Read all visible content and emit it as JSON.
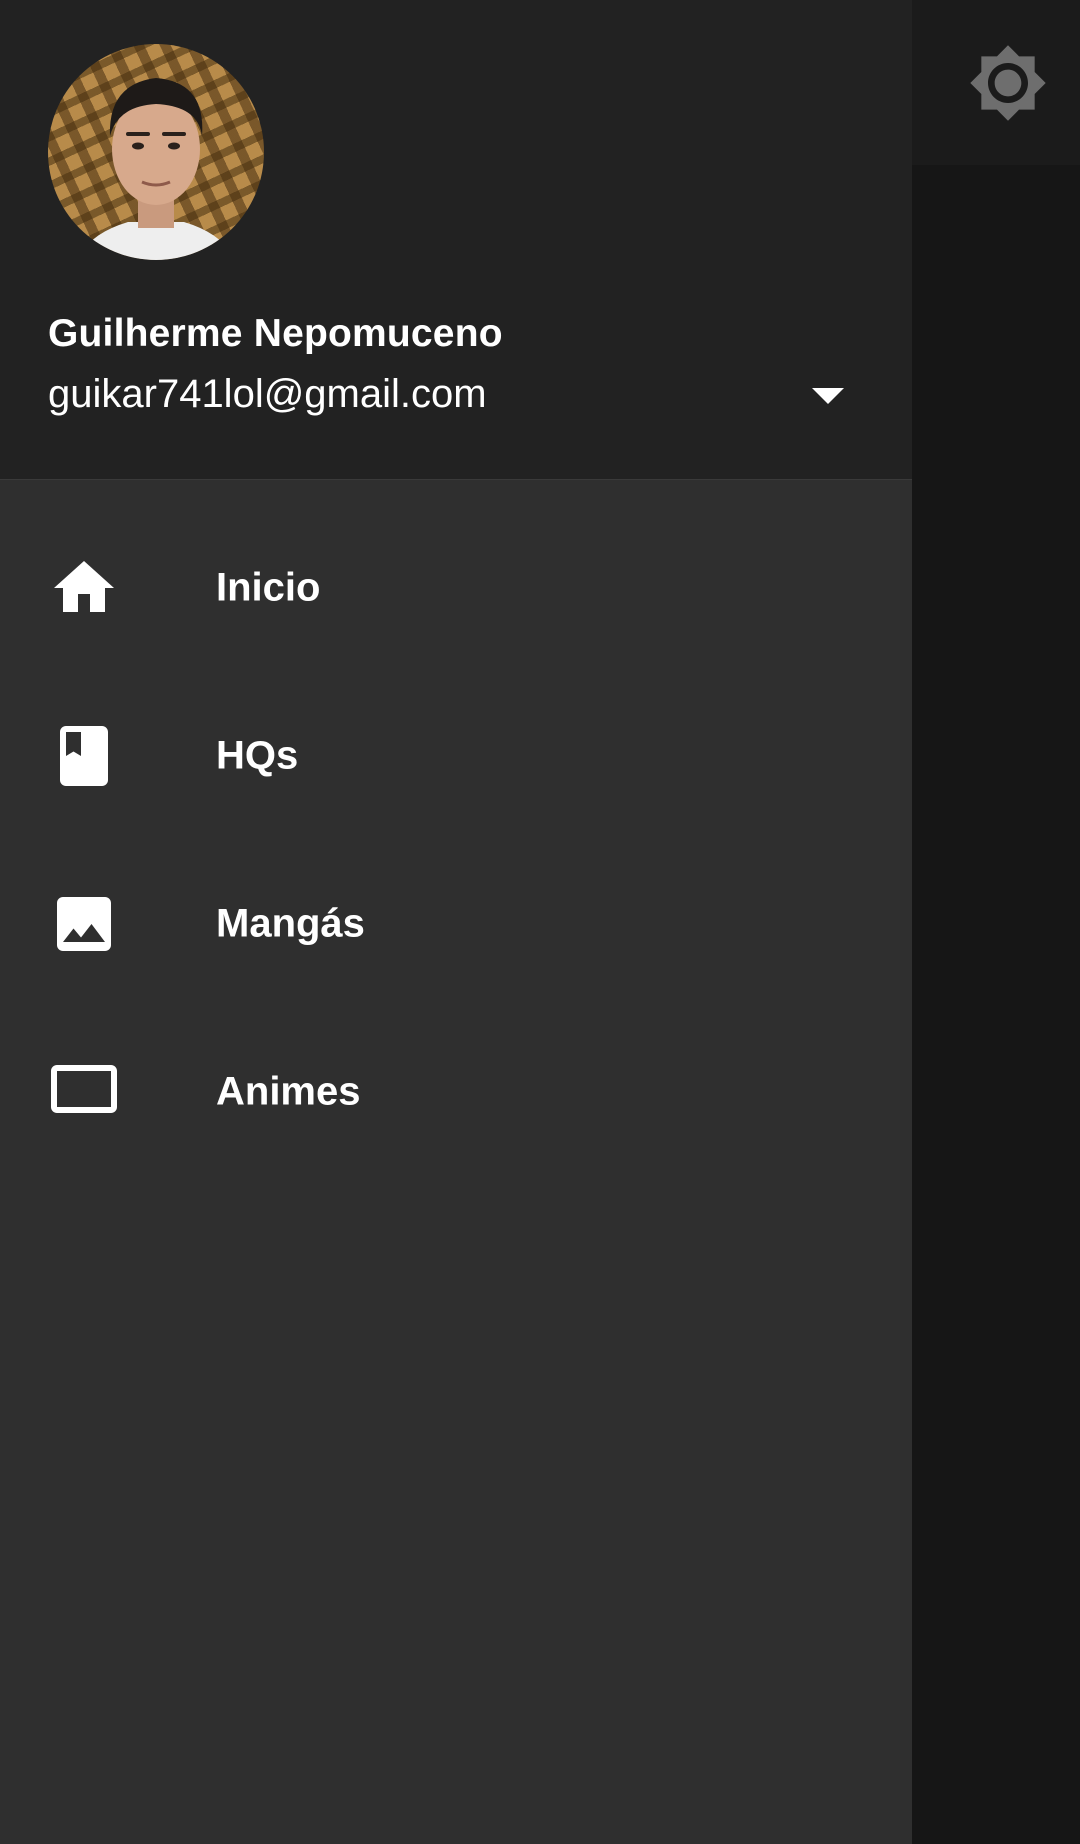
{
  "app": {
    "brightness_icon": "brightness-icon"
  },
  "drawer": {
    "header": {
      "avatar": "user-avatar-photo",
      "name": "Guilherme Nepomuceno",
      "email": "guikar741lol@gmail.com",
      "toggle_icon": "arrow-drop-down-icon"
    },
    "items": [
      {
        "label": "Inicio",
        "icon": "home-icon"
      },
      {
        "label": "HQs",
        "icon": "book-icon"
      },
      {
        "label": "Mangás",
        "icon": "image-icon"
      },
      {
        "label": "Animes",
        "icon": "tv-icon"
      }
    ]
  },
  "colors": {
    "drawer_bg": "#2f2f2f",
    "header_bg": "#222222",
    "text": "#ffffff",
    "scrim_bg": "#161616",
    "icon_dim": "#6e6e6e"
  }
}
